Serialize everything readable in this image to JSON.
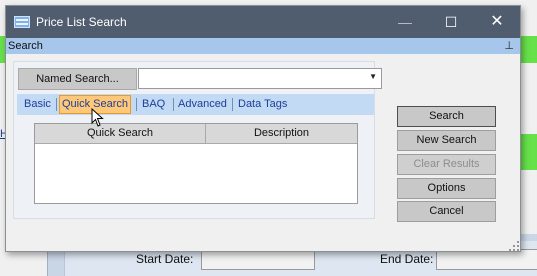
{
  "window": {
    "title": "Price List Search",
    "minimize_glyph": "—",
    "maximize_glyph": "☐",
    "close_glyph": "✕",
    "title_icon": "window-app-icon"
  },
  "search_panel": {
    "header_label": "Search",
    "pin_icon": "pin-icon",
    "pin_glyph": "⊥"
  },
  "named_search": {
    "button_label": "Named Search...",
    "combo_value": "",
    "combo_arrow": "▼"
  },
  "tabs": [
    {
      "label": "Basic",
      "active": false
    },
    {
      "label": "Quick Search",
      "active": true
    },
    {
      "label": "BAQ",
      "active": false
    },
    {
      "label": "Advanced",
      "active": false
    },
    {
      "label": "Data Tags",
      "active": false
    }
  ],
  "grid": {
    "columns": [
      "Quick Search",
      "Description"
    ],
    "rows": []
  },
  "actions": {
    "search": "Search",
    "new_search": "New Search",
    "clear_results": "Clear Results",
    "options": "Options",
    "cancel": "Cancel"
  },
  "background_form": {
    "start_date_label": "Start Date:",
    "start_date_value": "",
    "end_date_label": "End Date:",
    "end_date_value": "",
    "left_edge_char": "H"
  },
  "colors": {
    "titlebar": "#4f5d6f",
    "search_header": "#a7c6ec",
    "tab_bar": "#c2daf4",
    "active_tab": "#ffc879",
    "background_green": "#66e14a"
  }
}
